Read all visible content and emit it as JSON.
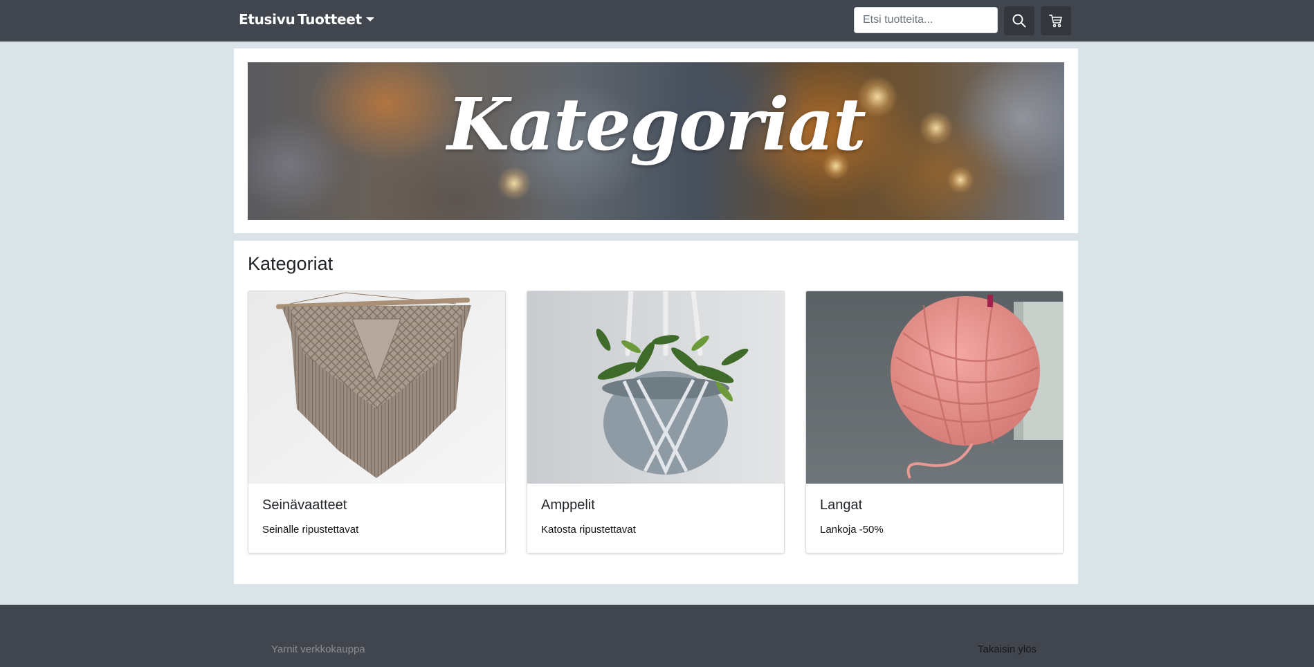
{
  "navbar": {
    "home_label": "Etusivu",
    "products_label": "Tuotteet",
    "search_placeholder": "Etsi tuotteita...",
    "search_icon": "search-icon",
    "cart_icon": "cart-icon"
  },
  "hero": {
    "title": "Kategoriat"
  },
  "categories": {
    "heading": "Kategoriat",
    "items": [
      {
        "title": "Seinävaatteet",
        "description": "Seinälle ripustettavat",
        "image": "macrame-wall-hanging"
      },
      {
        "title": "Amppelit",
        "description": "Katosta ripustettavat",
        "image": "macrame-plant-hanger"
      },
      {
        "title": "Langat",
        "description": "Lankoja -50%",
        "image": "pink-yarn-ball"
      }
    ]
  },
  "footer": {
    "brand": "Yarnit verkkokauppa",
    "back_to_top": "Takaisin ylös"
  },
  "colors": {
    "navbar": "#41454d",
    "page_background": "#dae4e8",
    "panel": "#ffffff"
  }
}
